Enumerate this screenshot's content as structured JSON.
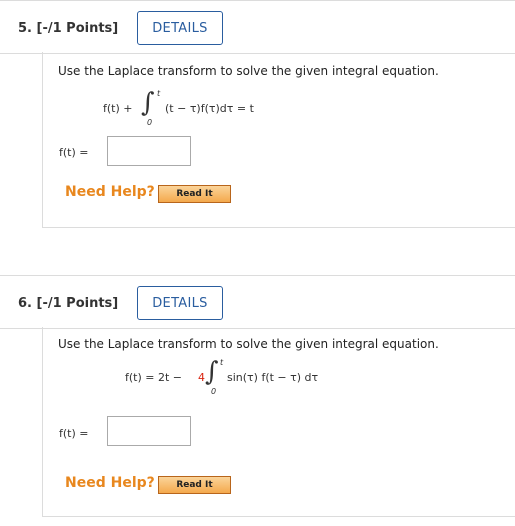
{
  "q5": {
    "number": "5.  [-/1 Points]",
    "details_label": "DETAILS",
    "prompt": "Use the Laplace transform to solve the given integral equation.",
    "eq_lhs": "f(t) +",
    "int_upper": "t",
    "int_lower": "0",
    "integrand": "(t − τ)f(τ)dτ = t",
    "answer_label": "f(t) =",
    "answer_value": "",
    "need_help": "Need Help?",
    "read_it": "Read It"
  },
  "q6": {
    "number": "6.  [-/1 Points]",
    "details_label": "DETAILS",
    "prompt": "Use the Laplace transform to solve the given integral equation.",
    "eq_lhs": "f(t) = 2t −",
    "eq_coef": "4",
    "int_upper": "t",
    "int_lower": "0",
    "integrand": "sin(τ) f(t − τ) dτ",
    "answer_label": "f(t) =",
    "answer_value": "",
    "need_help": "Need Help?",
    "read_it": "Read It"
  },
  "colors": {
    "details_border": "#2a5d9f",
    "need_help": "#e8871e",
    "highlight": "#d9230f"
  }
}
